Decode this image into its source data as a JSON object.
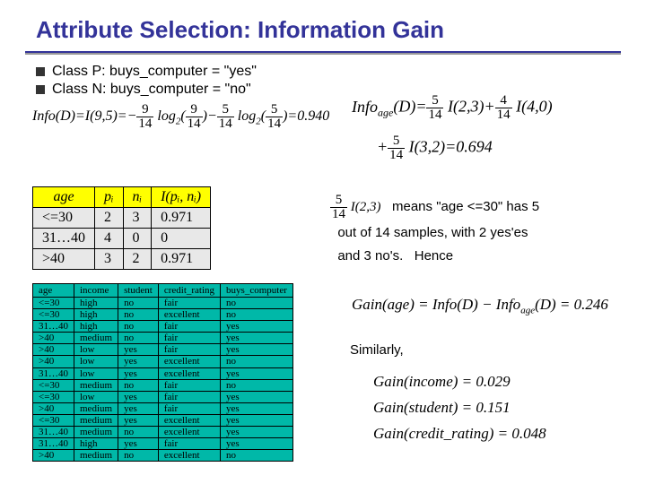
{
  "title": "Attribute Selection: Information Gain",
  "bullets": [
    "Class P: buys_computer = \"yes\"",
    "Class N: buys_computer = \"no\""
  ],
  "info_D": "Info(D) = I(9,5) = − (9/14) log₂(9/14) − (5/14) log₂(5/14) = 0.940",
  "info_age_line1": "Info_age(D) = (5/14) I(2,3) + (4/14) I(4,0)",
  "info_age_line2": "+ (5/14) I(3,2) = 0.694",
  "age_table": {
    "headers": [
      "age",
      "pᵢ",
      "nᵢ",
      "I(pᵢ, nᵢ)"
    ],
    "rows": [
      [
        "<=30",
        "2",
        "3",
        "0.971"
      ],
      [
        "31…40",
        "4",
        "0",
        "0"
      ],
      [
        ">40",
        "3",
        "2",
        "0.971"
      ]
    ]
  },
  "data_table": {
    "headers": [
      "age",
      "income",
      "student",
      "credit_rating",
      "buys_computer"
    ],
    "rows": [
      [
        "<=30",
        "high",
        "no",
        "fair",
        "no"
      ],
      [
        "<=30",
        "high",
        "no",
        "excellent",
        "no"
      ],
      [
        "31…40",
        "high",
        "no",
        "fair",
        "yes"
      ],
      [
        ">40",
        "medium",
        "no",
        "fair",
        "yes"
      ],
      [
        ">40",
        "low",
        "yes",
        "fair",
        "yes"
      ],
      [
        ">40",
        "low",
        "yes",
        "excellent",
        "no"
      ],
      [
        "31…40",
        "low",
        "yes",
        "excellent",
        "yes"
      ],
      [
        "<=30",
        "medium",
        "no",
        "fair",
        "no"
      ],
      [
        "<=30",
        "low",
        "yes",
        "fair",
        "yes"
      ],
      [
        ">40",
        "medium",
        "yes",
        "fair",
        "yes"
      ],
      [
        "<=30",
        "medium",
        "yes",
        "excellent",
        "yes"
      ],
      [
        "31…40",
        "medium",
        "no",
        "excellent",
        "yes"
      ],
      [
        "31…40",
        "high",
        "yes",
        "fair",
        "yes"
      ],
      [
        ">40",
        "medium",
        "no",
        "excellent",
        "no"
      ]
    ]
  },
  "means_prefix": "(5/14) I(2,3)",
  "means_text": " means \"age <=30\" has 5 out of 14 samples, with 2 yes'es and 3 no's.   Hence",
  "gain_age": "Gain(age) = Info(D) − Info_age(D) = 0.246",
  "similarly": "Similarly,",
  "gains": [
    "Gain(income) = 0.029",
    "Gain(student) = 0.151",
    "Gain(credit_rating) = 0.048"
  ]
}
